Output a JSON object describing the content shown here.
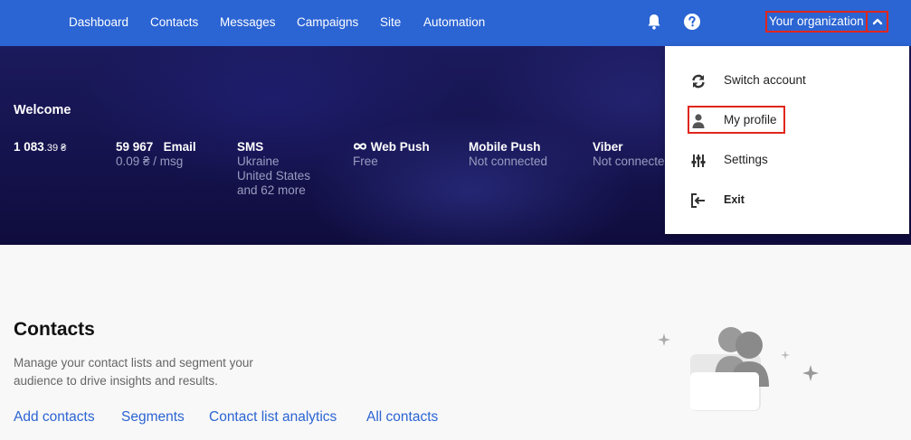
{
  "nav": {
    "items": [
      "Dashboard",
      "Contacts",
      "Messages",
      "Campaigns",
      "Site",
      "Automation"
    ],
    "notifications_icon": "bell-icon",
    "help_icon": "question-circle-icon",
    "org_label": "Your organization",
    "org_toggle_icon": "chevron-up-icon"
  },
  "hero": {
    "welcome": "Welcome",
    "balance": {
      "main": "1 083",
      "decimals": ".39 ₴"
    },
    "email": {
      "count": "59 967",
      "title": "Email",
      "sub": "0.09 ₴ / msg"
    },
    "sms": {
      "title": "SMS",
      "lines": [
        "Ukraine",
        "United States",
        "and 62 more"
      ]
    },
    "webpush": {
      "title": "Web Push",
      "icon": "infinity-icon",
      "sub": "Free"
    },
    "mobilepush": {
      "title": "Mobile Push",
      "sub": "Not connected"
    },
    "viber": {
      "title": "Viber",
      "sub": "Not connected"
    }
  },
  "dropdown": {
    "items": [
      {
        "label": "Switch account",
        "icon": "refresh-icon"
      },
      {
        "label": "My profile",
        "icon": "user-icon"
      },
      {
        "label": "Settings",
        "icon": "sliders-icon"
      },
      {
        "label": "Exit",
        "icon": "logout-icon"
      }
    ]
  },
  "contacts": {
    "title": "Contacts",
    "description": "Manage your contact lists and segment your audience to drive insights and results.",
    "links": [
      "Add contacts",
      "Segments",
      "Contact list analytics",
      "All contacts"
    ]
  },
  "colors": {
    "brand": "#2b64d3",
    "highlight": "#e0261b",
    "hero_bg": "#15134d"
  }
}
